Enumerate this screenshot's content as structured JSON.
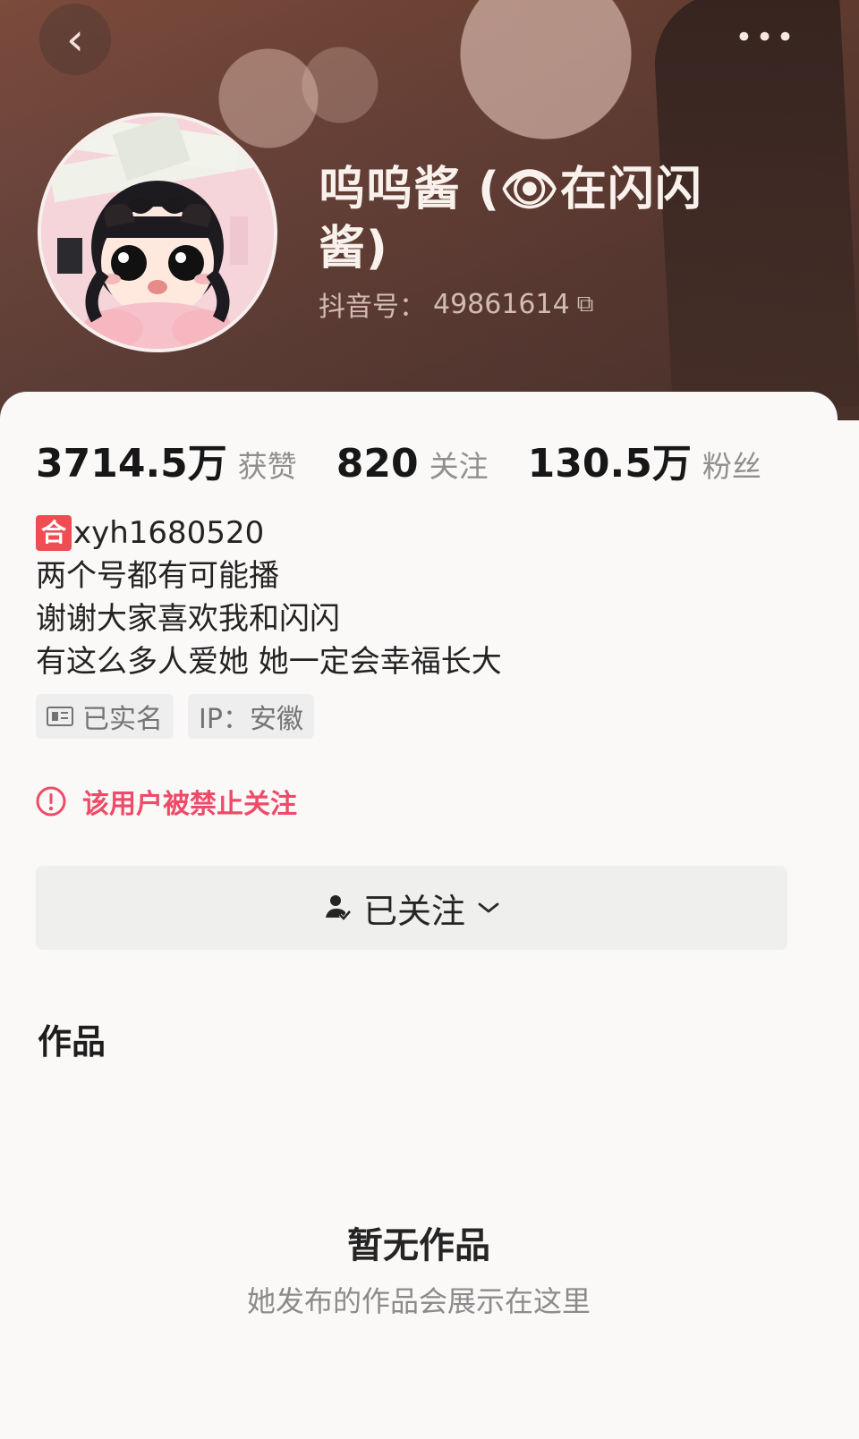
{
  "header": {
    "back_icon": "back-icon",
    "more_icon": "more-icon"
  },
  "profile": {
    "name_line1": "呜呜酱 (👁在闪闪",
    "name_line2": "酱)",
    "id_label": "抖音号：",
    "id_value": "49861614",
    "copy_icon": "copy-icon",
    "avatar_icon": "avatar-image"
  },
  "stats": [
    {
      "value": "3714.5万",
      "label": "获赞"
    },
    {
      "value": "820",
      "label": "关注"
    },
    {
      "value": "130.5万",
      "label": "粉丝"
    }
  ],
  "bio": {
    "badge": "合",
    "line1_rest": "xyh1680520",
    "line2": "两个号都有可能播",
    "line3": "谢谢大家喜欢我和闪闪",
    "line4": "有这么多人爱她 她一定会幸福长大"
  },
  "tags": [
    {
      "icon": "id-card-icon",
      "label": "已实名"
    },
    {
      "icon": "",
      "label": "IP：安徽"
    }
  ],
  "notice": {
    "icon": "warning-icon",
    "text": "该用户被禁止关注"
  },
  "follow": {
    "label": "已关注",
    "icon": "user-check-icon",
    "chevron": "chevron-down-icon"
  },
  "works": {
    "title": "作品",
    "empty_title": "暂无作品",
    "empty_subtitle": "她发布的作品会展示在这里"
  }
}
